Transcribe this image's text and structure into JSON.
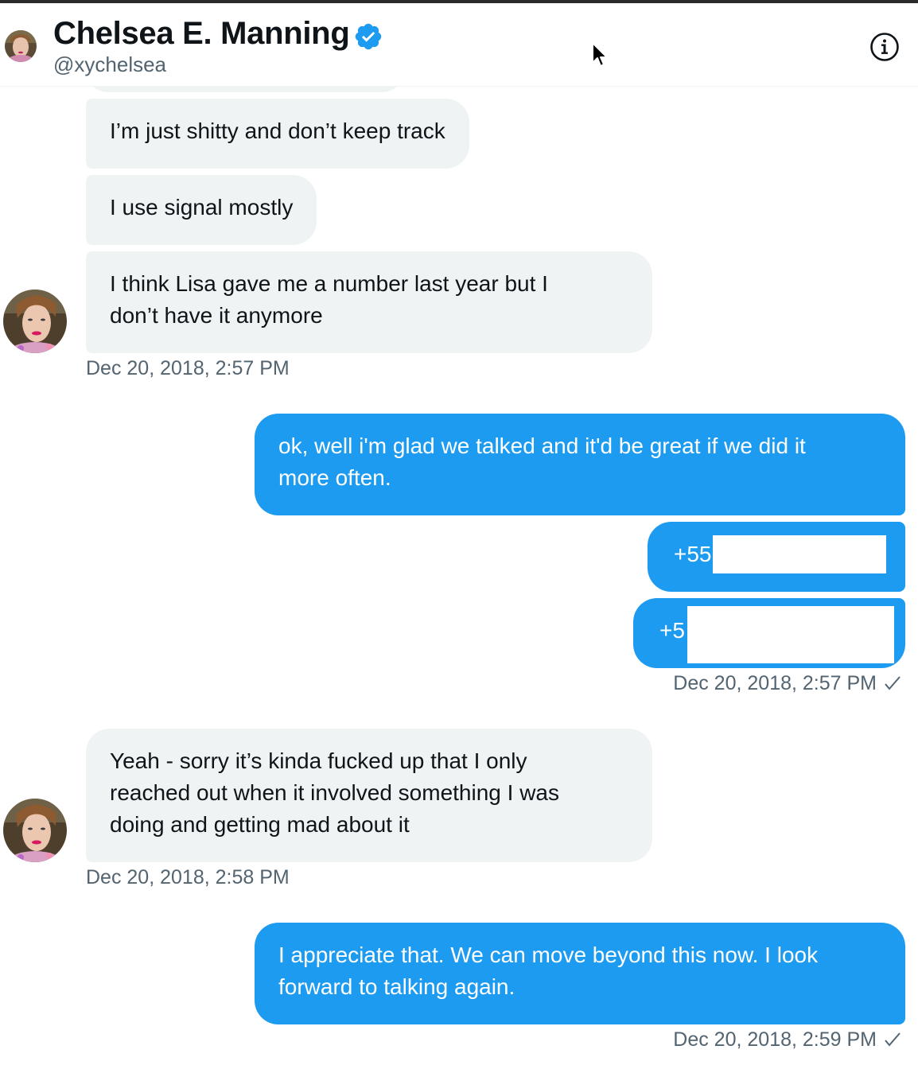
{
  "header": {
    "name": "Chelsea E. Manning",
    "handle": "@xychelsea"
  },
  "messages": {
    "m1": "I’m just shitty and don’t keep track",
    "m2": "I use signal mostly",
    "m3_line1": "I think Lisa gave me a number last year but I",
    "m3_line2": "don’t have it anymore",
    "ts1": "Dec 20, 2018, 2:57 PM",
    "m4_line1": "ok, well i'm glad we talked and it'd be great if we did it",
    "m4_line2": "more often.",
    "m5": "+55",
    "m6": "+5",
    "ts2": "Dec 20, 2018, 2:57 PM",
    "m7_line1": "Yeah - sorry it’s kinda fucked up that I only",
    "m7_line2": "reached out when it involved something I was",
    "m7_line3": "doing and getting mad about it",
    "ts3": "Dec 20, 2018, 2:58 PM",
    "m8_line1": "I appreciate that. We can move beyond this now. I look",
    "m8_line2": "forward to talking again.",
    "ts4": "Dec 20, 2018, 2:59 PM"
  },
  "colors": {
    "outgoing_bubble": "#1d9bf0",
    "incoming_bubble": "#eff3f4",
    "verified_badge": "#1d9bf0",
    "timestamp": "#536471"
  },
  "icons": {
    "verified": "verified-badge-icon",
    "info": "info-icon",
    "read": "check-icon",
    "cursor": "mouse-pointer-icon"
  }
}
